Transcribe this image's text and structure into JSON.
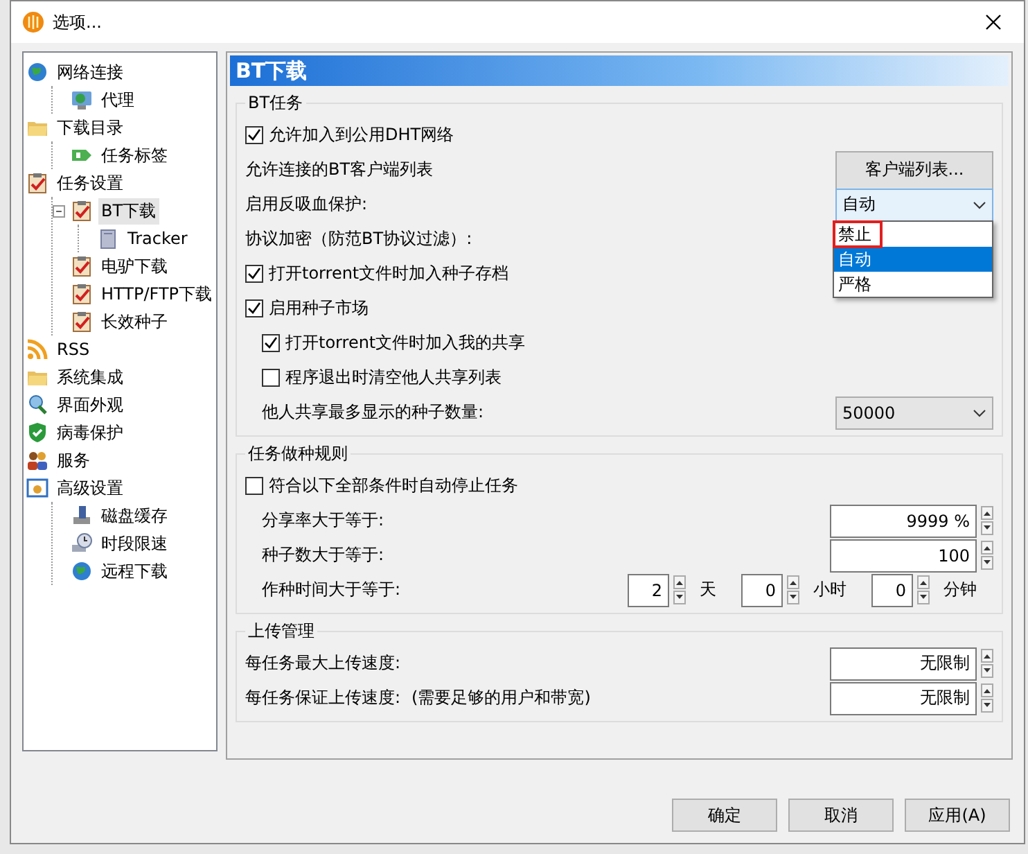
{
  "window": {
    "title": "选项..."
  },
  "tree": [
    {
      "label": "网络连接",
      "kind": "globe",
      "selected": false,
      "children": [
        {
          "label": "代理",
          "kind": "monitor",
          "selected": false
        }
      ]
    },
    {
      "label": "下载目录",
      "kind": "folder",
      "selected": false,
      "children": [
        {
          "label": "任务标签",
          "kind": "tag",
          "selected": false
        }
      ]
    },
    {
      "label": "任务设置",
      "kind": "clipboard",
      "selected": false,
      "children": [
        {
          "label": "BT下载",
          "kind": "clipboard",
          "selected": true,
          "expanded": true,
          "children": [
            {
              "label": "Tracker",
              "kind": "server",
              "selected": false
            }
          ]
        },
        {
          "label": "电驴下载",
          "kind": "clipboard",
          "selected": false
        },
        {
          "label": "HTTP/FTP下载",
          "kind": "clipboard",
          "selected": false
        },
        {
          "label": "长效种子",
          "kind": "clipboard",
          "selected": false
        }
      ]
    },
    {
      "label": "RSS",
      "kind": "rss",
      "selected": false
    },
    {
      "label": "系统集成",
      "kind": "folder",
      "selected": false
    },
    {
      "label": "界面外观",
      "kind": "magnifier",
      "selected": false
    },
    {
      "label": "病毒保护",
      "kind": "shield",
      "selected": false
    },
    {
      "label": "服务",
      "kind": "people",
      "selected": false
    },
    {
      "label": "高级设置",
      "kind": "window",
      "selected": false,
      "children": [
        {
          "label": "磁盘缓存",
          "kind": "disk",
          "selected": false
        },
        {
          "label": "时段限速",
          "kind": "clock",
          "selected": false
        },
        {
          "label": "远程下载",
          "kind": "globe",
          "selected": false
        }
      ]
    }
  ],
  "page_title": "BT下载",
  "groups": [
    {
      "title": "BT任务",
      "rows": [
        {
          "kind": "checkbox",
          "label": "允许加入到公用DHT网络",
          "checked": true
        },
        {
          "kind": "button",
          "label": "允许连接的BT客户端列表",
          "button": "客户端列表..."
        },
        {
          "kind": "select",
          "label": "启用反吸血保护:",
          "value": "自动",
          "expanded": true,
          "options": [
            {
              "label": "禁止",
              "selected": false,
              "annotated": true
            },
            {
              "label": "自动",
              "selected": true,
              "annotated": false
            },
            {
              "label": "严格",
              "selected": false,
              "annotated": false
            }
          ]
        },
        {
          "kind": "label",
          "label": "协议加密（防范BT协议过滤）:"
        },
        {
          "kind": "checkbox",
          "label": "打开torrent文件时加入种子存档",
          "checked": true
        },
        {
          "kind": "checkbox",
          "label": "启用种子市场",
          "checked": true,
          "children": [
            {
              "kind": "checkbox",
              "label": "打开torrent文件时加入我的共享",
              "checked": true
            },
            {
              "kind": "checkbox",
              "label": "程序退出时清空他人共享列表",
              "checked": false
            },
            {
              "kind": "select",
              "label": "他人共享最多显示的种子数量:",
              "value": "50000",
              "expanded": false
            }
          ]
        }
      ]
    },
    {
      "title": "任务做种规则",
      "rows": [
        {
          "kind": "checkbox",
          "label": "符合以下全部条件时自动停止任务",
          "checked": false,
          "children": [
            {
              "kind": "spin",
              "label": "分享率大于等于:",
              "value": "9999 %"
            },
            {
              "kind": "spin",
              "label": "种子数大于等于:",
              "value": "100"
            },
            {
              "kind": "duration",
              "label": "作种时间大于等于:",
              "fields": [
                {
                  "value": "2",
                  "unit": "天"
                },
                {
                  "value": "0",
                  "unit": "小时"
                },
                {
                  "value": "0",
                  "unit": "分钟"
                }
              ]
            }
          ]
        }
      ]
    },
    {
      "title": "上传管理",
      "rows": [
        {
          "kind": "spin",
          "label": "每任务最大上传速度:",
          "value": "无限制"
        },
        {
          "kind": "spin",
          "label": "每任务保证上传速度:",
          "note": "(需要足够的用户和带宽)",
          "value": "无限制"
        }
      ]
    }
  ],
  "buttons": [
    "确定",
    "取消",
    "应用(A)"
  ]
}
